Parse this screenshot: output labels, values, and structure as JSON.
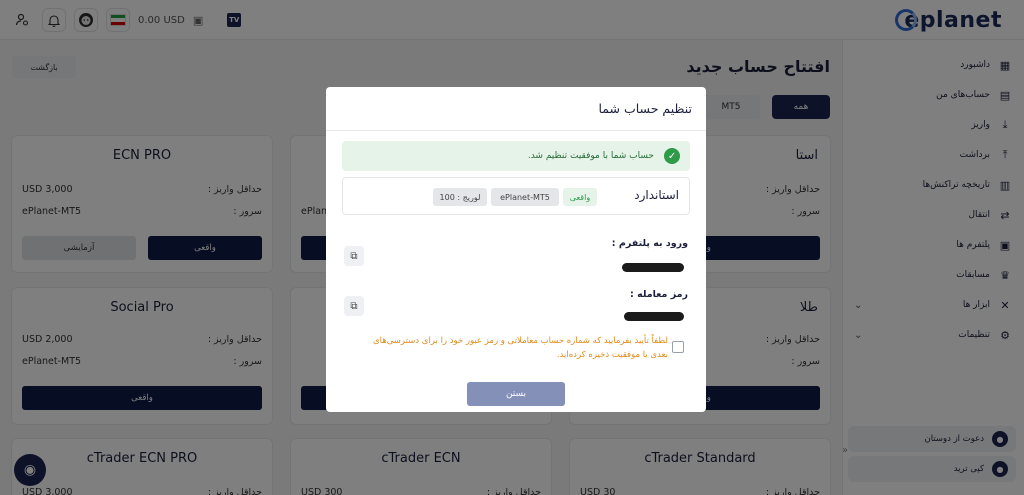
{
  "header": {
    "logo_text": "eplanet",
    "balance": "0.00 USD",
    "tv_label": "TV",
    "flag_colors": [
      "#239f40",
      "#ffffff",
      "#da0000"
    ],
    "icons": [
      "user-settings-icon",
      "bell-icon",
      "avatar-icon",
      "flag-icon",
      "wallet-icon",
      "tradingview-icon"
    ]
  },
  "sidebar": {
    "items": [
      {
        "label": "داشبورد",
        "icon": "dashboard-icon"
      },
      {
        "label": "حساب‌های من",
        "icon": "accounts-icon"
      },
      {
        "label": "واریز",
        "icon": "deposit-icon"
      },
      {
        "label": "برداشت",
        "icon": "withdraw-icon"
      },
      {
        "label": "تاریخچه تراکنش‌ها",
        "icon": "history-icon"
      },
      {
        "label": "انتقال",
        "icon": "transfer-icon"
      },
      {
        "label": "پلتفرم ها",
        "icon": "platform-icon"
      },
      {
        "label": "مسابقات",
        "icon": "trophy-icon"
      },
      {
        "label": "ابزار ها",
        "icon": "tools-icon"
      },
      {
        "label": "تنظیمات",
        "icon": "settings-icon"
      }
    ],
    "invite": "دعوت از دوستان",
    "copy_trade": "کپی ترید"
  },
  "main": {
    "back_label": "بازگشت",
    "title": "افتتاح حساب جدید",
    "filters": {
      "all": "همه",
      "mt5": "MT5"
    },
    "min_deposit_label": "حداقل واریز :",
    "server_label": "سرور :",
    "real_label": "واقعی",
    "demo_label": "آزمایشی",
    "cards": [
      {
        "name": "ECN PRO",
        "min": "USD 3,000",
        "server": "ePlanet-MT5"
      },
      {
        "name": "",
        "min": "",
        "server": "ePlan"
      },
      {
        "name": "استا",
        "min": "",
        "server": ""
      },
      {
        "name": "Social Pro",
        "min": "USD 2,000",
        "server": "ePlanet-MT5"
      },
      {
        "name": "",
        "min": "",
        "server": ""
      },
      {
        "name": "طلا",
        "min": "",
        "server": ""
      },
      {
        "name": "cTrader ECN PRO",
        "min": "USD 3,000"
      },
      {
        "name": "cTrader ECN",
        "min": "USD 300"
      },
      {
        "name": "cTrader Standard",
        "min": "USD 30"
      }
    ]
  },
  "modal": {
    "title": "تنظیم حساب شما",
    "success_message": "حساب شما با موفقیت تنظیم شد.",
    "account_type": "استاندارد",
    "tag_real": "واقعی",
    "tag_server": "ePlanet-MT5",
    "tag_leverage": "لوریج : 100",
    "login_label": "ورود به پلتفرم :",
    "password_label": "رمز معامله :",
    "confirm_text": "لطفاً تأیید بفرمایید که شماره حساب معاملاتی و رمز عبور خود را برای دسترسی‌های بعدی با موفقیت ذخیره کرده‌اید.",
    "close_label": "بستن"
  },
  "colors": {
    "primary": "#0f1a45",
    "success": "#2e9a4a",
    "warning": "#e08a1a",
    "close_button_disabled": "#8490b8"
  }
}
